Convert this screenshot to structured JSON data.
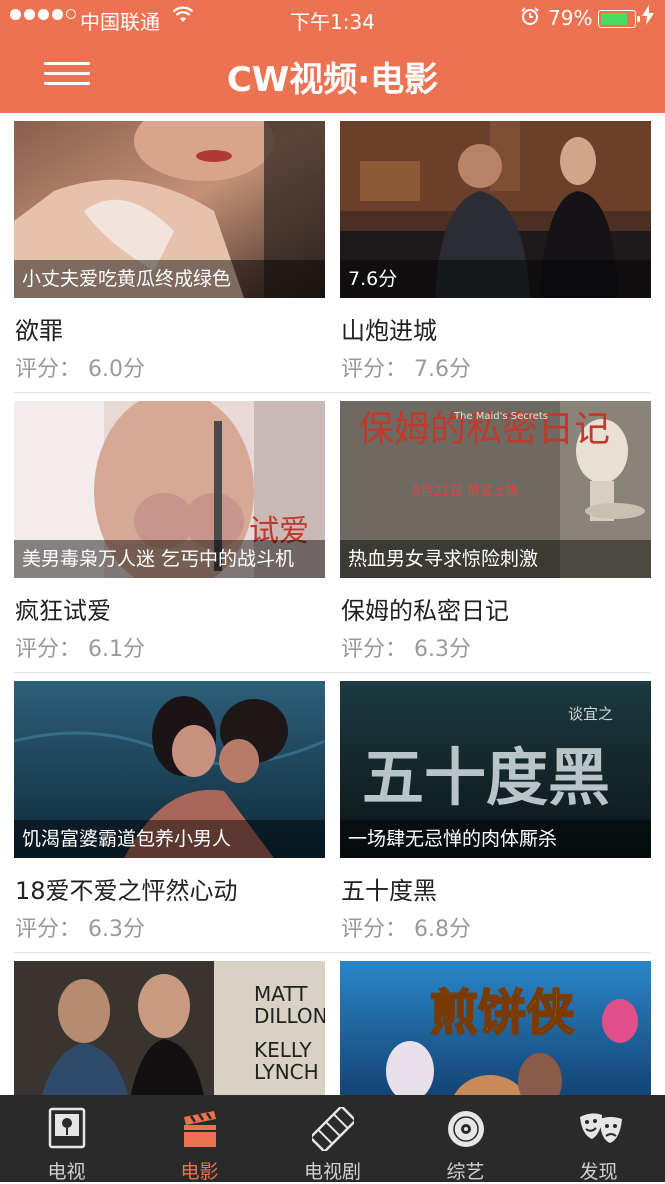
{
  "status_bar": {
    "carrier": "中国联通",
    "time": "下午1:34",
    "battery": "79%"
  },
  "header": {
    "title": "CW视频·电影"
  },
  "movies": [
    {
      "caption": "小丈夫爱吃黄瓜终成绿色",
      "title": "欲罪",
      "rating": "评分： 6.0分"
    },
    {
      "caption": "7.6分",
      "title": "山炮进城",
      "rating": "评分： 7.6分"
    },
    {
      "caption": "美男毒枭万人迷 乞丐中的战斗机",
      "title": "疯狂试爱",
      "rating": "评分： 6.1分"
    },
    {
      "caption": "热血男女寻求惊险刺激",
      "title": "保姆的私密日记",
      "rating": "评分： 6.3分",
      "poster_text": "保姆的私密日记",
      "poster_subtext": "8月21日 情爱上映",
      "poster_en": "The Maid's Secrets"
    },
    {
      "caption": "饥渴富婆霸道包养小男人",
      "title": "18爱不爱之怦然心动",
      "rating": "评分： 6.3分"
    },
    {
      "caption": "一场肆无忌惮的肉体厮杀",
      "title": "五十度黑",
      "rating": "评分： 6.8分",
      "poster_text": "五十度黑",
      "poster_subtext": "谈宜之"
    },
    {
      "poster_text": "MATT DILLON KELLY LYNCH"
    },
    {
      "poster_text": "煎饼侠"
    }
  ],
  "tabs": [
    {
      "label": "电视",
      "icon": "tv-icon",
      "active": false
    },
    {
      "label": "电影",
      "icon": "clapperboard-icon",
      "active": true
    },
    {
      "label": "电视剧",
      "icon": "film-strip-icon",
      "active": false
    },
    {
      "label": "综艺",
      "icon": "disc-icon",
      "active": false
    },
    {
      "label": "发现",
      "icon": "theater-masks-icon",
      "active": false
    }
  ],
  "colors": {
    "accent": "#ed7251",
    "tabbar": "#2a2a2a"
  }
}
